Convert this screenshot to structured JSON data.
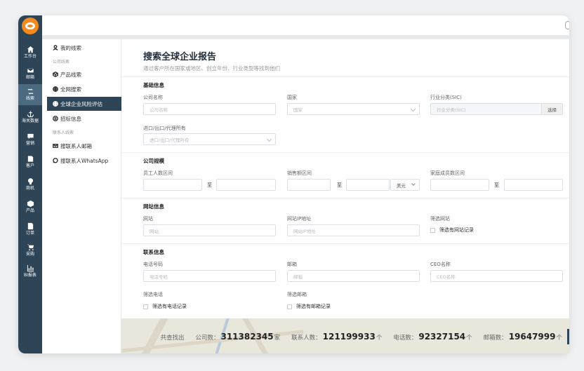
{
  "rail": {
    "items": [
      {
        "label": "工作台",
        "icon": "home-icon"
      },
      {
        "label": "邮箱",
        "icon": "mail-icon"
      },
      {
        "label": "线索",
        "icon": "clue-icon"
      },
      {
        "label": "海关数据",
        "icon": "anchor-icon"
      },
      {
        "label": "营销",
        "icon": "chat-icon"
      },
      {
        "label": "客户",
        "icon": "customer-icon"
      },
      {
        "label": "商机",
        "icon": "bulb-icon"
      },
      {
        "label": "产品",
        "icon": "box-icon"
      },
      {
        "label": "订单",
        "icon": "order-icon"
      },
      {
        "label": "采购",
        "icon": "cart-icon"
      },
      {
        "label": "BI报表",
        "icon": "chart-icon"
      }
    ],
    "active": "线索"
  },
  "sidebar": {
    "my_clues": "我的线索",
    "public_head": "公司线索",
    "product_search": "产品线索",
    "global_search": "全网搜索",
    "risk_eval": "全球企业风险评估",
    "bid_info": "招标信息",
    "contact_head": "联系人线索",
    "search_email": "搜联系人邮箱",
    "search_whatsapp": "搜联系人WhatsApp"
  },
  "main": {
    "title": "搜索全球企业报告",
    "subtitle": "通过客户所在国家或地区、创立年份、行业类型等找到他们",
    "basic": {
      "heading": "基础信息",
      "company_label": "公司名称",
      "company_ph": "公司名称",
      "country_label": "国家",
      "country_ph": "国家",
      "industry_label": "行业分类(SIC)",
      "industry_ph": "行业分类(SIC)",
      "choose": "选择",
      "ioa_label": "进口/出口/代理所有",
      "ioa_ph": "进口/出口/代理所有"
    },
    "scale": {
      "heading": "公司规模",
      "emp_label": "员工人数区间",
      "sales_label": "销售额区间",
      "family_label": "家庭成员数区间",
      "to": "至",
      "unit": "美元"
    },
    "web": {
      "heading": "网站信息",
      "site_label": "网站",
      "site_ph": "网站",
      "ip_label": "网站IP地址",
      "ip_ph": "网站IP地址",
      "filter_label": "筛选网站",
      "filter_cb": "筛选有网站记录"
    },
    "contact": {
      "heading": "联系信息",
      "phone_label": "电话号码",
      "phone_ph": "电话号码",
      "email_label": "邮箱",
      "email_ph": "邮箱",
      "ceo_label": "CEO名称",
      "ceo_ph": "CEO名称",
      "fphone_label": "筛选电话",
      "fphone_cb": "筛选有电话记录",
      "femail_label": "筛选邮箱",
      "femail_cb": "筛选有邮箱记录"
    }
  },
  "stats": {
    "prefix": "共查找出",
    "company_label": "公司数：",
    "company_num": "311382345",
    "company_unit": "家",
    "contact_label": "联系人数：",
    "contact_num": "121199933",
    "contact_unit": "个",
    "phone_label": "电话数：",
    "phone_num": "92327154",
    "phone_unit": "个",
    "email_label": "邮箱数：",
    "email_num": "19647999",
    "email_unit": "个"
  },
  "colors": {
    "rail": "#2d4557",
    "active": "#4b6a80",
    "logo": "#f28a1e"
  }
}
